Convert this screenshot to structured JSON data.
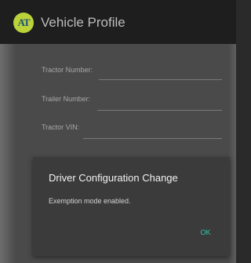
{
  "app_bar": {
    "logo_text": "AT",
    "title": "Vehicle Profile"
  },
  "form": {
    "fields": [
      {
        "label": "Tractor Number:",
        "value": ""
      },
      {
        "label": "Trailer Number:",
        "value": ""
      },
      {
        "label": "Tractor VIN:",
        "value": ""
      }
    ]
  },
  "dialog": {
    "title": "Driver Configuration Change",
    "message": "Exemption mode enabled.",
    "ok_label": "OK"
  },
  "colors": {
    "app_bar_bg": "#1e1e1e",
    "dim_background": "#4a4a4a",
    "dialog_bg": "#3b3b3b",
    "accent": "#34c7a6",
    "logo_bg": "#bcd23a",
    "logo_fg": "#1a4f7a"
  }
}
